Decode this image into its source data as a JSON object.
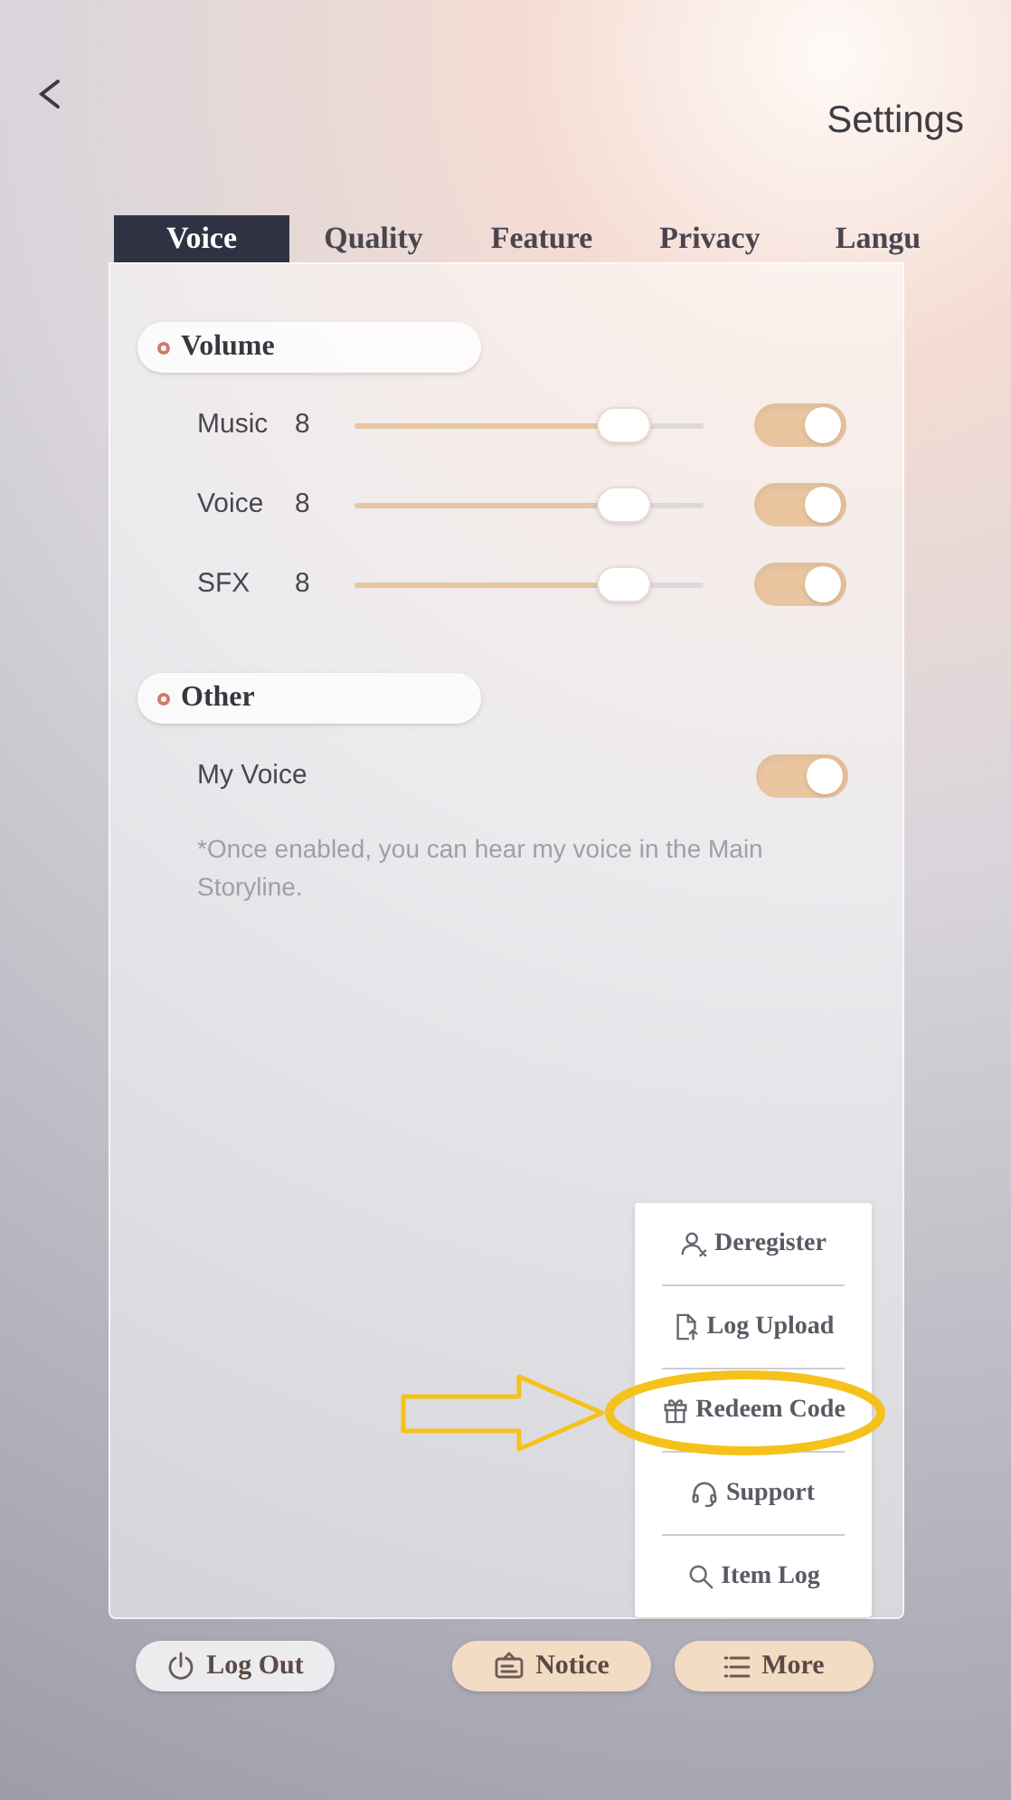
{
  "header": {
    "title": "Settings"
  },
  "tabs": [
    {
      "label": "Voice",
      "selected": true
    },
    {
      "label": "Quality",
      "selected": false
    },
    {
      "label": "Feature",
      "selected": false
    },
    {
      "label": "Privacy",
      "selected": false
    },
    {
      "label": "Langu",
      "selected": false
    }
  ],
  "sections": [
    {
      "title": "Volume",
      "rows": [
        {
          "kind": "slider",
          "label": "Music",
          "value": "8",
          "level": 0.77,
          "on": true
        },
        {
          "kind": "slider",
          "label": "Voice",
          "value": "8",
          "level": 0.77,
          "on": true
        },
        {
          "kind": "slider",
          "label": "SFX",
          "value": "8",
          "level": 0.77,
          "on": true
        }
      ]
    },
    {
      "title": "Other",
      "rows": [
        {
          "kind": "toggle",
          "label": "My Voice",
          "on": true
        }
      ],
      "note": "*Once enabled, you can hear my voice in the Main Storyline."
    }
  ],
  "menu": {
    "items": [
      {
        "label": "Deregister"
      },
      {
        "label": "Log Upload"
      },
      {
        "label": "Redeem Code"
      },
      {
        "label": "Support"
      },
      {
        "label": "Item Log"
      }
    ]
  },
  "buttons": [
    {
      "label": "Log Out",
      "kind": "plain"
    },
    {
      "label": "Notice",
      "kind": "accent"
    },
    {
      "label": "More",
      "kind": "accent"
    }
  ]
}
